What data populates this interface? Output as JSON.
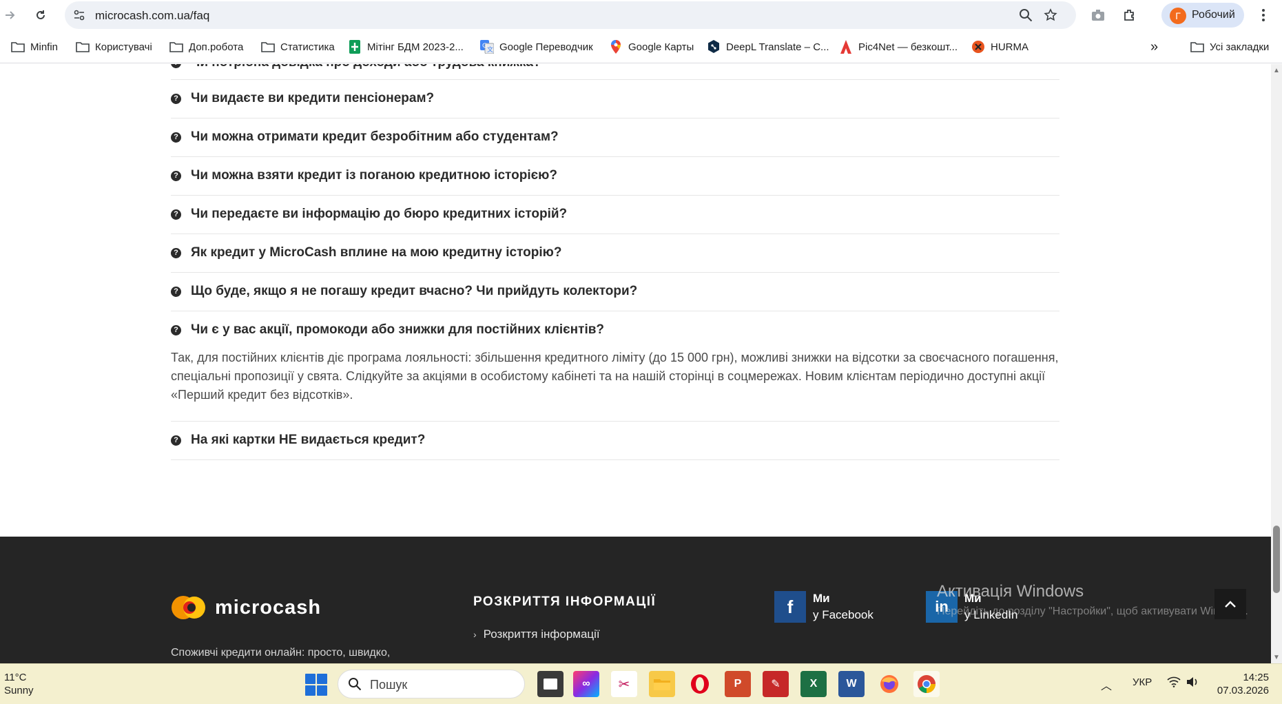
{
  "browser": {
    "url": "microcash.com.ua/faq",
    "profile": {
      "initial": "Г",
      "name": "Робочий"
    },
    "bookmarks": [
      {
        "label": "Minfin",
        "icon": "folder-icon"
      },
      {
        "label": "Користувачі",
        "icon": "folder-icon"
      },
      {
        "label": "Доп.робота",
        "icon": "folder-icon"
      },
      {
        "label": "Статистика",
        "icon": "folder-icon"
      },
      {
        "label": "Мітінг БДМ 2023-2...",
        "icon": "sheets-icon"
      },
      {
        "label": "Google Переводчик",
        "icon": "translate-icon"
      },
      {
        "label": "Google Карты",
        "icon": "maps-pin-icon"
      },
      {
        "label": "DeepL Translate – С...",
        "icon": "deepl-icon"
      },
      {
        "label": "Pic4Net — безкошт...",
        "icon": "pic4net-icon"
      },
      {
        "label": "HURMA",
        "icon": "hurma-icon"
      }
    ],
    "all_bookmarks": "Усі закладки"
  },
  "faq": {
    "partial_top": "Чи потрібна довідка про доходи або трудова книжка?",
    "questions": [
      "Чи видаєте ви кредити пенсіонерам?",
      "Чи можна отримати кредит безробітним або студентам?",
      "Чи можна взяти кредит із поганою кредитною історією?",
      "Чи передаєте ви інформацію до бюро кредитних історій?",
      "Як кредит у MicroCash вплине на мою кредитну історію?",
      "Що буде, якщо я не погашу кредит вчасно? Чи прийдуть колектори?",
      "Чи є у вас акції, промокоди або знижки для постійних клієнтів?"
    ],
    "open_answer": "Так, для постійних клієнтів діє програма лояльності: збільшення кредитного ліміту (до 15 000 грн), можливі знижки на відсотки за своєчасного погашення, спеціальні пропозиції у свята. Слідкуйте за акціями в особистому кабінеті та на нашій сторінці в соцмережах. Новим клієнтам періодично доступні акції «Перший кредит без відсотків».",
    "last_question": "На які картки НЕ видається кредит?"
  },
  "footer": {
    "logo_text": "microcash",
    "tagline": "Споживчі кредити онлайн: просто, швидко,",
    "disclosure_heading": "РОЗКРИТТЯ ІНФОРМАЦІЇ",
    "disclosure_link": "Розкриття інформації",
    "facebook": {
      "line1": "Ми",
      "line2": "у Facebook"
    },
    "linkedin": {
      "line1": "Ми",
      "line2": "у LinkedIn"
    },
    "windows_activation_title": "Активація Windows",
    "windows_activation_sub": "Перейдіть до розділу \"Настройки\", щоб активувати Windows."
  },
  "taskbar": {
    "weather_temp": "11°C",
    "weather_desc": "Sunny",
    "search_label": "Пошук",
    "language": "УКР",
    "time": "14:25",
    "date": "07.03.2026"
  },
  "colors": {
    "footer_bg": "#252525",
    "brand_orange": "#f39200",
    "facebook_blue": "#1f4e8c",
    "linkedin_blue": "#1a66a8",
    "taskbar_bg": "#f4f0cf"
  }
}
